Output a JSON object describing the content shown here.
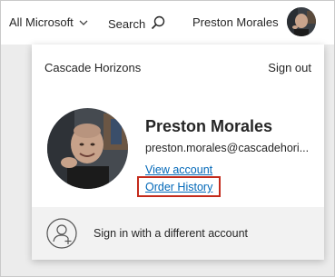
{
  "header": {
    "all_microsoft": "All Microsoft",
    "search": "Search",
    "user_name": "Preston Morales"
  },
  "account_panel": {
    "org_name": "Cascade Horizons",
    "sign_out": "Sign out",
    "name": "Preston Morales",
    "email": "preston.morales@cascadehori...",
    "view_account": "View account",
    "order_history": "Order History",
    "sign_in_different": "Sign in with a different account"
  },
  "colors": {
    "link": "#0067b8",
    "highlight": "#c42b1c"
  },
  "icons": [
    "chevron-down-icon",
    "search-icon",
    "add-person-icon"
  ]
}
